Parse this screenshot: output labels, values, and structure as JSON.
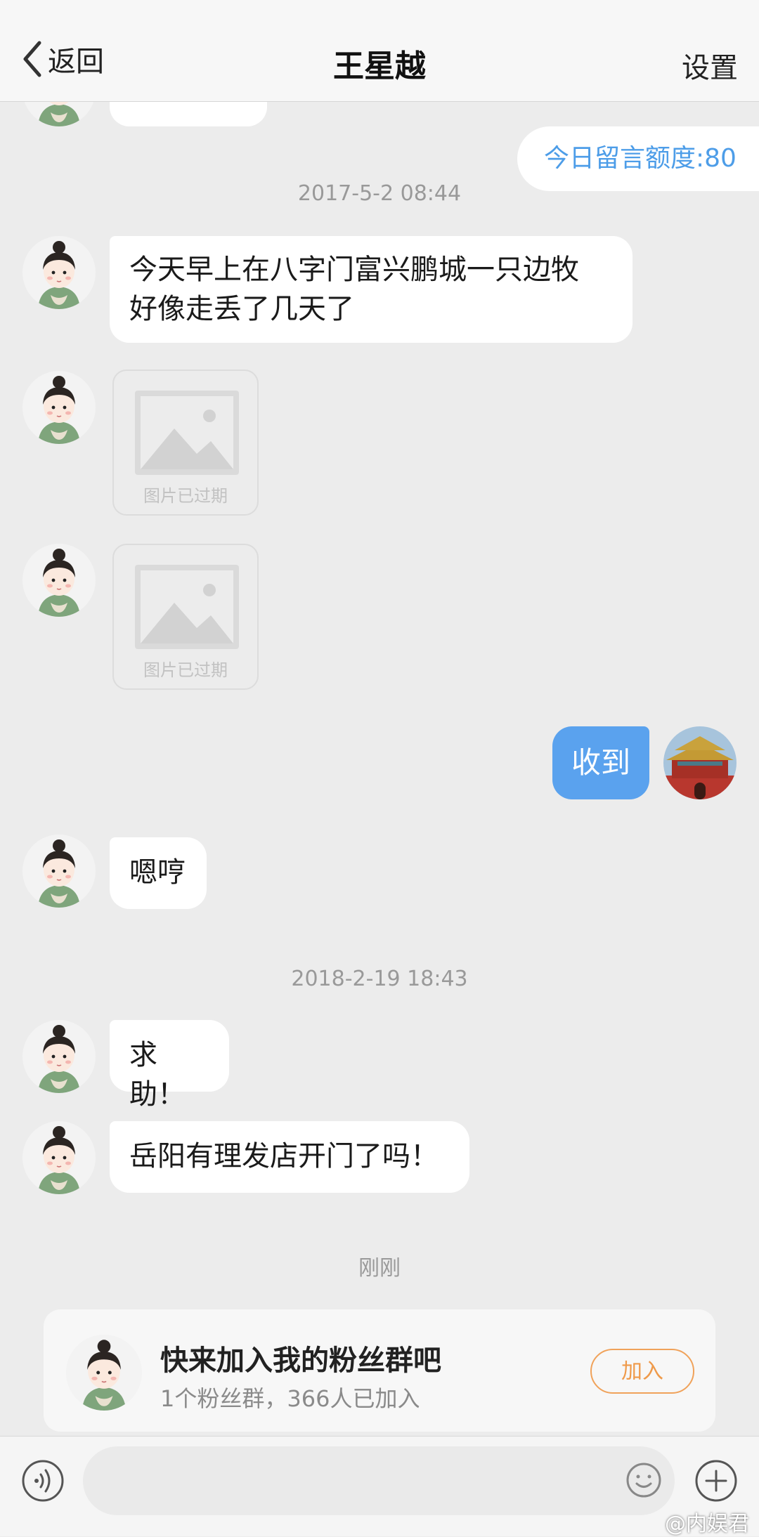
{
  "header": {
    "back_label": "返回",
    "title": "王星越",
    "settings_label": "设置"
  },
  "quota_text": "今日留言额度:80",
  "messages": {
    "ts1": "2017-5-2 08:44",
    "msg1": "今天早上在八字门富兴鹏城一只边牧\n好像走丢了几天了",
    "expired_label": "图片已过期",
    "my_reply": "收到",
    "msg2": "嗯哼",
    "ts2": "2018-2-19 18:43",
    "msg3": "求助！",
    "msg4": "岳阳有理发店开门了吗！",
    "ts3": "刚刚"
  },
  "fan_group": {
    "title": "快来加入我的粉丝群吧",
    "subtitle": "1个粉丝群，366人已加入",
    "join_label": "加入"
  },
  "input": {
    "placeholder": ""
  },
  "watermark": "@内娱君",
  "colors": {
    "accent_blue": "#5aa2ee",
    "quota_text": "#4d9de8",
    "join_orange": "#ef9a4a"
  }
}
